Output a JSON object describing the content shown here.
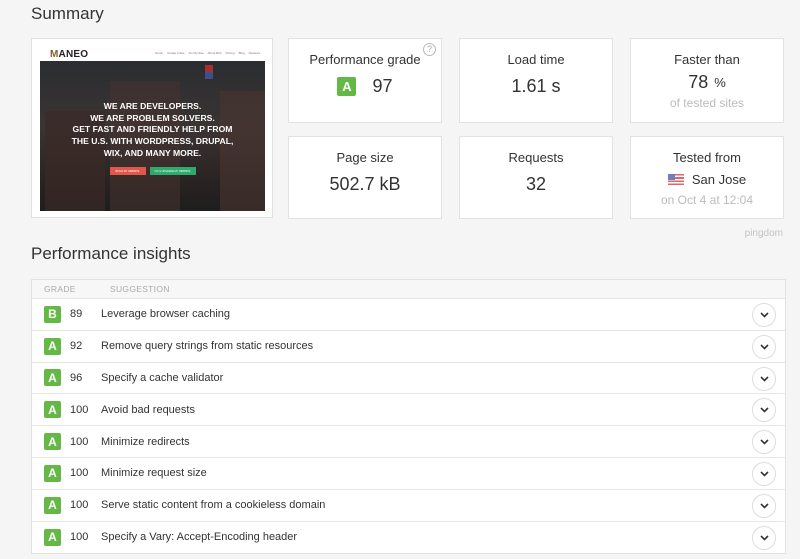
{
  "summary": {
    "title": "Summary",
    "thumbnail": {
      "logo_first": "M",
      "logo_rest": "ANEO",
      "nav": [
        "Home",
        "Create a Site",
        "Fix My Site",
        "About Bob",
        "Pricing",
        "Blog",
        "Reviews"
      ],
      "headline": [
        "WE ARE DEVELOPERS.",
        "WE ARE PROBLEM SOLVERS.",
        "GET FAST AND FRIENDLY HELP FROM",
        "THE U.S. WITH WORDPRESS, DRUPAL,",
        "WIX, AND MANY MORE."
      ],
      "button_primary": "BUILD MY WEBSITE",
      "button_secondary": "FIX & UPGRADE MY WEBSITE"
    },
    "cards": {
      "performance": {
        "label": "Performance grade",
        "grade": "A",
        "value": "97",
        "help": "?"
      },
      "load_time": {
        "label": "Load time",
        "value": "1.61 s"
      },
      "faster_than": {
        "label": "Faster than",
        "value": "78",
        "unit": "%",
        "sub": "of tested sites"
      },
      "page_size": {
        "label": "Page size",
        "value": "502.7 kB"
      },
      "requests": {
        "label": "Requests",
        "value": "32"
      },
      "tested_from": {
        "label": "Tested from",
        "location": "San Jose",
        "sub": "on Oct 4 at 12:04",
        "flag": "us-flag"
      }
    },
    "brand": "pingdom"
  },
  "insights": {
    "title": "Performance insights",
    "columns": [
      "GRADE",
      "SUGGESTION"
    ],
    "rows": [
      {
        "grade": "B",
        "score": "89",
        "suggestion": "Leverage browser caching"
      },
      {
        "grade": "A",
        "score": "92",
        "suggestion": "Remove query strings from static resources"
      },
      {
        "grade": "A",
        "score": "96",
        "suggestion": "Specify a cache validator"
      },
      {
        "grade": "A",
        "score": "100",
        "suggestion": "Avoid bad requests"
      },
      {
        "grade": "A",
        "score": "100",
        "suggestion": "Minimize redirects"
      },
      {
        "grade": "A",
        "score": "100",
        "suggestion": "Minimize request size"
      },
      {
        "grade": "A",
        "score": "100",
        "suggestion": "Serve static content from a cookieless domain"
      },
      {
        "grade": "A",
        "score": "100",
        "suggestion": "Specify a Vary: Accept-Encoding header"
      }
    ]
  },
  "colors": {
    "grade_green": "#64b946",
    "background": "#f5f5f5"
  }
}
